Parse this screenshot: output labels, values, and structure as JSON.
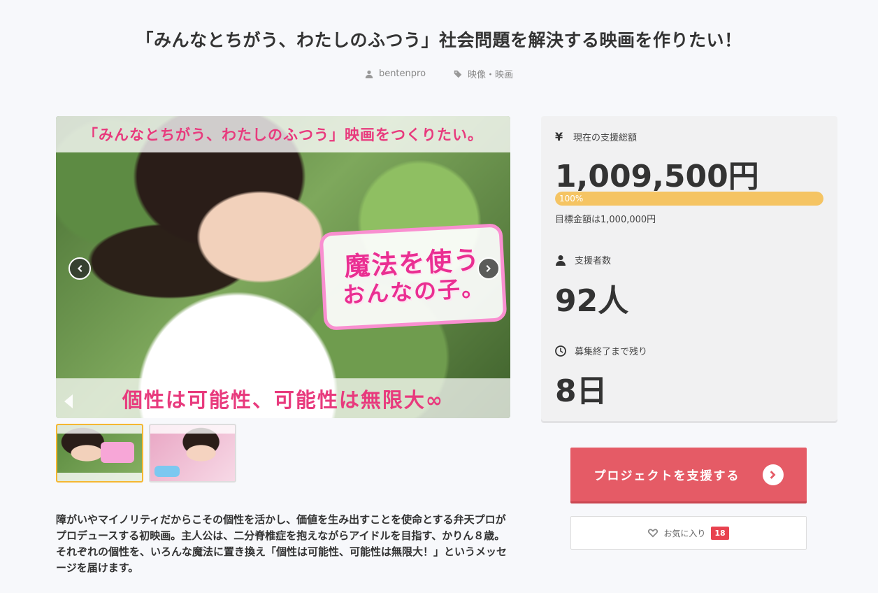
{
  "project": {
    "title": "「みんなとちがう、わたしのふつう」社会問題を解決する映画を作りたい！",
    "author": "bentenpro",
    "category": "映像・映画",
    "description": "障がいやマイノリティだからこその個性を活かし、価値を生み出すことを使命とする弁天プロがプロデュースする初映画。主人公は、二分脊椎症を抱えながらアイドルを目指す、かりん８歳。それぞれの個性を、いろんな魔法に置き換え「個性は可能性、可能性は無限大！」というメッセージを届けます。"
  },
  "slider": {
    "banner_top": "「みんなとちがう、わたしのふつう」映画をつくりたい。",
    "logo_line1": "魔法を使う",
    "logo_line2": "おんなの子。",
    "banner_bottom": "個性は可能性、可能性は無限大∞",
    "thumbnails": [
      "thumb-1",
      "thumb-2"
    ]
  },
  "stats": {
    "amount_label": "現在の支援総額",
    "amount_value": "1,009,500円",
    "progress_text": "100%",
    "progress_percent": 100,
    "goal_text": "目標金額は1,000,000円",
    "supporters_label": "支援者数",
    "supporters_value": "92人",
    "remaining_label": "募集終了まで残り",
    "remaining_value": "8日"
  },
  "actions": {
    "support_label": "プロジェクトを支援する",
    "favorite_label": "お気に入り",
    "favorite_count": "18"
  },
  "colors": {
    "accent": "#e55b66",
    "progress": "#f5c463",
    "banner_text": "#e83a7d"
  }
}
